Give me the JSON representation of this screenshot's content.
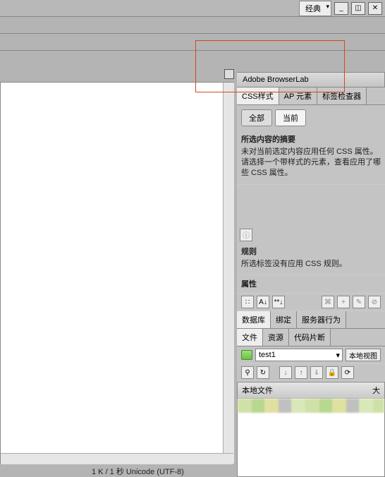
{
  "top": {
    "workspace": "经典",
    "min": "_",
    "max": "◫",
    "close": "✕"
  },
  "panels": {
    "browserlab": "Adobe BrowserLab",
    "css_tabs": [
      "CSS样式",
      "AP 元素",
      "标签检查器"
    ],
    "pills": {
      "all": "全部",
      "current": "当前"
    },
    "summary": {
      "title": "所选内容的摘要",
      "body1": "未对当前选定内容应用任何 CSS 属性。",
      "body2": "请选择一个带样式的元素，查看应用了哪些 CSS 属性。"
    },
    "rules": {
      "title": "规则",
      "body": "所选标签没有应用 CSS 规则。"
    },
    "props": {
      "title": "属性",
      "az": "A↓",
      "cat": "∷",
      "star": "**↓",
      "link": "⌘",
      "add": "+",
      "edit": "✎",
      "del": "⊘"
    },
    "db_tabs": [
      "数据库",
      "绑定",
      "服务器行为"
    ],
    "file_tabs": [
      "文件",
      "资源",
      "代码片断"
    ],
    "site": "test1",
    "view_btn": "本地视图",
    "toolbar": {
      "t1": "⚲",
      "t2": "↻",
      "t3": "↓",
      "t4": "↑",
      "t5": "⇓",
      "t6": "🔒",
      "t7": "⟳"
    },
    "files_hdr": {
      "col1": "本地文件",
      "col2": "大"
    }
  },
  "status": "1 K / 1 秒 Unicode (UTF-8)"
}
